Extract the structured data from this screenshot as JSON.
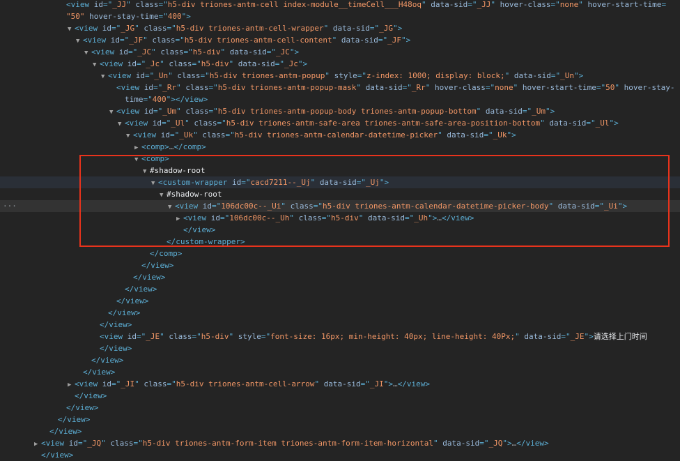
{
  "colors": {
    "background": "#242424",
    "tag": "#5db0d7",
    "attr_name": "#9bbbdc",
    "attr_value": "#f29766",
    "highlight_box": "#e8331c"
  },
  "lines": [
    {
      "indent": 97,
      "tw": "",
      "toks": [
        [
          "tag",
          "<view "
        ],
        [
          "an",
          "id"
        ],
        [
          "tag",
          "=\""
        ],
        [
          "av",
          "_JJ"
        ],
        [
          "tag",
          "\" "
        ],
        [
          "an",
          "class"
        ],
        [
          "tag",
          "=\""
        ],
        [
          "av",
          "h5-div triones-antm-cell index-module__timeCell___H48oq"
        ],
        [
          "tag",
          "\" "
        ],
        [
          "an",
          "data-sid"
        ],
        [
          "tag",
          "=\""
        ],
        [
          "av",
          "_JJ"
        ],
        [
          "tag",
          "\" "
        ],
        [
          "an",
          "hover-class"
        ],
        [
          "tag",
          "=\""
        ],
        [
          "av",
          "none"
        ],
        [
          "tag",
          "\" "
        ],
        [
          "an",
          "hover-start-time"
        ],
        [
          "tag",
          "="
        ]
      ]
    },
    {
      "indent": 97,
      "tw": "",
      "toks": [
        [
          "av",
          "\"50\""
        ],
        [
          "tag",
          " "
        ],
        [
          "an",
          "hover-stay-time"
        ],
        [
          "tag",
          "=\""
        ],
        [
          "av",
          "400"
        ],
        [
          "tag",
          "\">"
        ]
      ]
    },
    {
      "indent": 109,
      "tw": "▼",
      "toks": [
        [
          "tag",
          "<view "
        ],
        [
          "an",
          "id"
        ],
        [
          "tag",
          "=\""
        ],
        [
          "av",
          "_JG"
        ],
        [
          "tag",
          "\" "
        ],
        [
          "an",
          "class"
        ],
        [
          "tag",
          "=\""
        ],
        [
          "av",
          "h5-div triones-antm-cell-wrapper"
        ],
        [
          "tag",
          "\" "
        ],
        [
          "an",
          "data-sid"
        ],
        [
          "tag",
          "=\""
        ],
        [
          "av",
          "_JG"
        ],
        [
          "tag",
          "\">"
        ]
      ]
    },
    {
      "indent": 121,
      "tw": "▼",
      "toks": [
        [
          "tag",
          "<view "
        ],
        [
          "an",
          "id"
        ],
        [
          "tag",
          "=\""
        ],
        [
          "av",
          "_JF"
        ],
        [
          "tag",
          "\" "
        ],
        [
          "an",
          "class"
        ],
        [
          "tag",
          "=\""
        ],
        [
          "av",
          "h5-div triones-antm-cell-content"
        ],
        [
          "tag",
          "\" "
        ],
        [
          "an",
          "data-sid"
        ],
        [
          "tag",
          "=\""
        ],
        [
          "av",
          "_JF"
        ],
        [
          "tag",
          "\">"
        ]
      ]
    },
    {
      "indent": 133,
      "tw": "▼",
      "toks": [
        [
          "tag",
          "<view "
        ],
        [
          "an",
          "id"
        ],
        [
          "tag",
          "=\""
        ],
        [
          "av",
          "_JC"
        ],
        [
          "tag",
          "\" "
        ],
        [
          "an",
          "class"
        ],
        [
          "tag",
          "=\""
        ],
        [
          "av",
          "h5-div"
        ],
        [
          "tag",
          "\" "
        ],
        [
          "an",
          "data-sid"
        ],
        [
          "tag",
          "=\""
        ],
        [
          "av",
          "_JC"
        ],
        [
          "tag",
          "\">"
        ]
      ]
    },
    {
      "indent": 145,
      "tw": "▼",
      "toks": [
        [
          "tag",
          "<view "
        ],
        [
          "an",
          "id"
        ],
        [
          "tag",
          "=\""
        ],
        [
          "av",
          "_Jc"
        ],
        [
          "tag",
          "\" "
        ],
        [
          "an",
          "class"
        ],
        [
          "tag",
          "=\""
        ],
        [
          "av",
          "h5-div"
        ],
        [
          "tag",
          "\" "
        ],
        [
          "an",
          "data-sid"
        ],
        [
          "tag",
          "=\""
        ],
        [
          "av",
          "_Jc"
        ],
        [
          "tag",
          "\">"
        ]
      ]
    },
    {
      "indent": 157,
      "tw": "▼",
      "toks": [
        [
          "tag",
          "<view "
        ],
        [
          "an",
          "id"
        ],
        [
          "tag",
          "=\""
        ],
        [
          "av",
          "_Un"
        ],
        [
          "tag",
          "\" "
        ],
        [
          "an",
          "class"
        ],
        [
          "tag",
          "=\""
        ],
        [
          "av",
          "h5-div triones-antm-popup"
        ],
        [
          "tag",
          "\" "
        ],
        [
          "an",
          "style"
        ],
        [
          "tag",
          "=\""
        ],
        [
          "av",
          "z-index: 1000; display: block;"
        ],
        [
          "tag",
          "\" "
        ],
        [
          "an",
          "data-sid"
        ],
        [
          "tag",
          "=\""
        ],
        [
          "av",
          "_Un"
        ],
        [
          "tag",
          "\">"
        ]
      ]
    },
    {
      "indent": 169,
      "tw": "",
      "toks": [
        [
          "tag",
          "<view "
        ],
        [
          "an",
          "id"
        ],
        [
          "tag",
          "=\""
        ],
        [
          "av",
          "_Rr"
        ],
        [
          "tag",
          "\" "
        ],
        [
          "an",
          "class"
        ],
        [
          "tag",
          "=\""
        ],
        [
          "av",
          "h5-div triones-antm-popup-mask"
        ],
        [
          "tag",
          "\" "
        ],
        [
          "an",
          "data-sid"
        ],
        [
          "tag",
          "=\""
        ],
        [
          "av",
          "_Rr"
        ],
        [
          "tag",
          "\" "
        ],
        [
          "an",
          "hover-class"
        ],
        [
          "tag",
          "=\""
        ],
        [
          "av",
          "none"
        ],
        [
          "tag",
          "\" "
        ],
        [
          "an",
          "hover-start-time"
        ],
        [
          "tag",
          "=\""
        ],
        [
          "av",
          "50"
        ],
        [
          "tag",
          "\" "
        ],
        [
          "an",
          "hover-stay-"
        ]
      ]
    },
    {
      "indent": 181,
      "tw": "",
      "toks": [
        [
          "an",
          "time"
        ],
        [
          "tag",
          "=\""
        ],
        [
          "av",
          "400"
        ],
        [
          "tag",
          "\"></view>"
        ]
      ]
    },
    {
      "indent": 169,
      "tw": "▼",
      "toks": [
        [
          "tag",
          "<view "
        ],
        [
          "an",
          "id"
        ],
        [
          "tag",
          "=\""
        ],
        [
          "av",
          "_Um"
        ],
        [
          "tag",
          "\" "
        ],
        [
          "an",
          "class"
        ],
        [
          "tag",
          "=\""
        ],
        [
          "av",
          "h5-div triones-antm-popup-body triones-antm-popup-bottom"
        ],
        [
          "tag",
          "\" "
        ],
        [
          "an",
          "data-sid"
        ],
        [
          "tag",
          "=\""
        ],
        [
          "av",
          "_Um"
        ],
        [
          "tag",
          "\">"
        ]
      ]
    },
    {
      "indent": 181,
      "tw": "▼",
      "toks": [
        [
          "tag",
          "<view "
        ],
        [
          "an",
          "id"
        ],
        [
          "tag",
          "=\""
        ],
        [
          "av",
          "_Ul"
        ],
        [
          "tag",
          "\" "
        ],
        [
          "an",
          "class"
        ],
        [
          "tag",
          "=\""
        ],
        [
          "av",
          "h5-div triones-antm-safe-area triones-antm-safe-area-position-bottom"
        ],
        [
          "tag",
          "\" "
        ],
        [
          "an",
          "data-sid"
        ],
        [
          "tag",
          "=\""
        ],
        [
          "av",
          "_Ul"
        ],
        [
          "tag",
          "\">"
        ]
      ]
    },
    {
      "indent": 193,
      "tw": "▼",
      "toks": [
        [
          "tag",
          "<view "
        ],
        [
          "an",
          "id"
        ],
        [
          "tag",
          "=\""
        ],
        [
          "av",
          "_Uk"
        ],
        [
          "tag",
          "\" "
        ],
        [
          "an",
          "class"
        ],
        [
          "tag",
          "=\""
        ],
        [
          "av",
          "h5-div triones-antm-calendar-datetime-picker"
        ],
        [
          "tag",
          "\" "
        ],
        [
          "an",
          "data-sid"
        ],
        [
          "tag",
          "=\""
        ],
        [
          "av",
          "_Uk"
        ],
        [
          "tag",
          "\">"
        ]
      ]
    },
    {
      "indent": 205,
      "tw": "▶",
      "toks": [
        [
          "tag",
          "<comp>"
        ],
        [
          "ell",
          "…"
        ],
        [
          "tag",
          "</comp>"
        ]
      ]
    },
    {
      "indent": 205,
      "tw": "▼",
      "toks": [
        [
          "tag",
          "<comp>"
        ]
      ]
    },
    {
      "indent": 217,
      "tw": "▼",
      "toks": [
        [
          "sr",
          "#shadow-root"
        ]
      ]
    },
    {
      "indent": 229,
      "tw": "▼",
      "hl": true,
      "toks": [
        [
          "tag",
          "<custom-wrapper "
        ],
        [
          "an",
          "id"
        ],
        [
          "tag",
          "=\""
        ],
        [
          "av",
          "cacd7211--_Uj"
        ],
        [
          "tag",
          "\" "
        ],
        [
          "an",
          "data-sid"
        ],
        [
          "tag",
          "=\""
        ],
        [
          "av",
          "_Uj"
        ],
        [
          "tag",
          "\">"
        ]
      ]
    },
    {
      "indent": 241,
      "tw": "▼",
      "toks": [
        [
          "sr",
          "#shadow-root"
        ]
      ]
    },
    {
      "indent": 253,
      "tw": "▼",
      "sel": true,
      "gutter": "···",
      "toks": [
        [
          "tag",
          "<view "
        ],
        [
          "an",
          "id"
        ],
        [
          "tag",
          "=\""
        ],
        [
          "av",
          "106dc00c--_Ui"
        ],
        [
          "tag",
          "\" "
        ],
        [
          "an",
          "class"
        ],
        [
          "tag",
          "=\""
        ],
        [
          "av",
          "h5-div triones-antm-calendar-datetime-picker-body"
        ],
        [
          "tag",
          "\" "
        ],
        [
          "an",
          "data-sid"
        ],
        [
          "tag",
          "=\""
        ],
        [
          "av",
          "_Ui"
        ],
        [
          "tag",
          "\">"
        ]
      ]
    },
    {
      "indent": 265,
      "tw": "▶",
      "toks": [
        [
          "tag",
          "<view "
        ],
        [
          "an",
          "id"
        ],
        [
          "tag",
          "=\""
        ],
        [
          "av",
          "106dc00c--_Uh"
        ],
        [
          "tag",
          "\" "
        ],
        [
          "an",
          "class"
        ],
        [
          "tag",
          "=\""
        ],
        [
          "av",
          "h5-div"
        ],
        [
          "tag",
          "\" "
        ],
        [
          "an",
          "data-sid"
        ],
        [
          "tag",
          "=\""
        ],
        [
          "av",
          "_Uh"
        ],
        [
          "tag",
          "\">"
        ],
        [
          "ell",
          "…"
        ],
        [
          "tag",
          "</view>"
        ]
      ]
    },
    {
      "indent": 265,
      "tw": "",
      "toks": [
        [
          "tag",
          "</view>"
        ]
      ]
    },
    {
      "indent": 241,
      "tw": "",
      "toks": [
        [
          "tag",
          "</custom-wrapper>"
        ]
      ]
    },
    {
      "indent": 217,
      "tw": "",
      "toks": [
        [
          "tag",
          "</comp>"
        ]
      ]
    },
    {
      "indent": 205,
      "tw": "",
      "toks": [
        [
          "tag",
          "</view>"
        ]
      ]
    },
    {
      "indent": 193,
      "tw": "",
      "toks": [
        [
          "tag",
          "</view>"
        ]
      ]
    },
    {
      "indent": 181,
      "tw": "",
      "toks": [
        [
          "tag",
          "</view>"
        ]
      ]
    },
    {
      "indent": 169,
      "tw": "",
      "toks": [
        [
          "tag",
          "</view>"
        ]
      ]
    },
    {
      "indent": 157,
      "tw": "",
      "toks": [
        [
          "tag",
          "</view>"
        ]
      ]
    },
    {
      "indent": 145,
      "tw": "",
      "toks": [
        [
          "tag",
          "</view>"
        ]
      ]
    },
    {
      "indent": 145,
      "tw": "",
      "toks": [
        [
          "tag",
          "<view "
        ],
        [
          "an",
          "id"
        ],
        [
          "tag",
          "=\""
        ],
        [
          "av",
          "_JE"
        ],
        [
          "tag",
          "\" "
        ],
        [
          "an",
          "class"
        ],
        [
          "tag",
          "=\""
        ],
        [
          "av",
          "h5-div"
        ],
        [
          "tag",
          "\" "
        ],
        [
          "an",
          "style"
        ],
        [
          "tag",
          "=\""
        ],
        [
          "av",
          "font-size: 16px; min-height: 40px; line-height: 40Px;"
        ],
        [
          "tag",
          "\" "
        ],
        [
          "an",
          "data-sid"
        ],
        [
          "tag",
          "=\""
        ],
        [
          "av",
          "_JE"
        ],
        [
          "tag",
          "\">"
        ],
        [
          "txt",
          "请选择上门时间"
        ]
      ]
    },
    {
      "indent": 145,
      "tw": "",
      "toks": [
        [
          "tag",
          "</view>"
        ]
      ]
    },
    {
      "indent": 133,
      "tw": "",
      "toks": [
        [
          "tag",
          "</view>"
        ]
      ]
    },
    {
      "indent": 121,
      "tw": "",
      "toks": [
        [
          "tag",
          "</view>"
        ]
      ]
    },
    {
      "indent": 109,
      "tw": "▶",
      "toks": [
        [
          "tag",
          "<view "
        ],
        [
          "an",
          "id"
        ],
        [
          "tag",
          "=\""
        ],
        [
          "av",
          "_JI"
        ],
        [
          "tag",
          "\" "
        ],
        [
          "an",
          "class"
        ],
        [
          "tag",
          "=\""
        ],
        [
          "av",
          "h5-div triones-antm-cell-arrow"
        ],
        [
          "tag",
          "\" "
        ],
        [
          "an",
          "data-sid"
        ],
        [
          "tag",
          "=\""
        ],
        [
          "av",
          "_JI"
        ],
        [
          "tag",
          "\">"
        ],
        [
          "ell",
          "…"
        ],
        [
          "tag",
          "</view>"
        ]
      ]
    },
    {
      "indent": 109,
      "tw": "",
      "toks": [
        [
          "tag",
          "</view>"
        ]
      ]
    },
    {
      "indent": 97,
      "tw": "",
      "toks": [
        [
          "tag",
          "</view>"
        ]
      ]
    },
    {
      "indent": 85,
      "tw": "",
      "toks": [
        [
          "tag",
          "</view>"
        ]
      ]
    },
    {
      "indent": 73,
      "tw": "",
      "toks": [
        [
          "tag",
          "</view>"
        ]
      ]
    },
    {
      "indent": 61,
      "tw": "▶",
      "toks": [
        [
          "tag",
          "<view "
        ],
        [
          "an",
          "id"
        ],
        [
          "tag",
          "=\""
        ],
        [
          "av",
          "_JQ"
        ],
        [
          "tag",
          "\" "
        ],
        [
          "an",
          "class"
        ],
        [
          "tag",
          "=\""
        ],
        [
          "av",
          "h5-div triones-antm-form-item triones-antm-form-item-horizontal"
        ],
        [
          "tag",
          "\" "
        ],
        [
          "an",
          "data-sid"
        ],
        [
          "tag",
          "=\""
        ],
        [
          "av",
          "_JQ"
        ],
        [
          "tag",
          "\">"
        ],
        [
          "ell",
          "…"
        ],
        [
          "tag",
          "</view>"
        ]
      ]
    },
    {
      "indent": 61,
      "tw": "",
      "toks": [
        [
          "tag",
          "</view>"
        ]
      ]
    }
  ]
}
